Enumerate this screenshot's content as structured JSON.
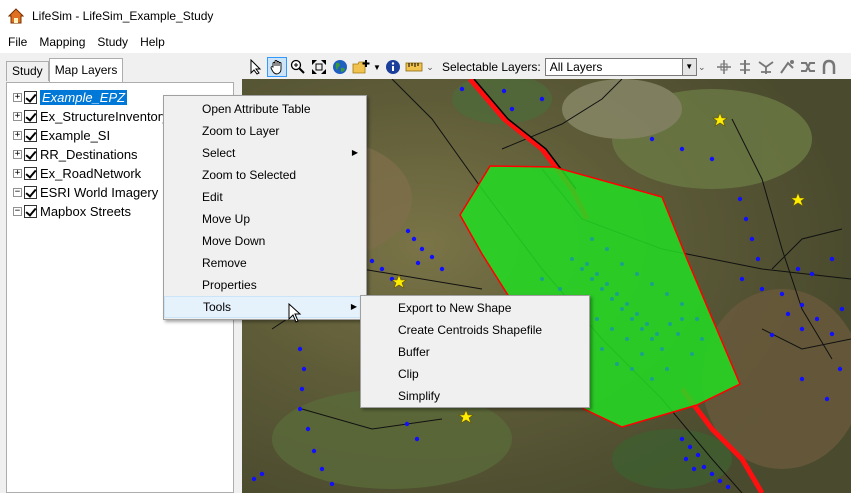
{
  "window": {
    "title": "LifeSim - LifeSim_Example_Study"
  },
  "menubar": {
    "items": [
      "File",
      "Mapping",
      "Study",
      "Help"
    ]
  },
  "tabs": [
    {
      "label": "Study",
      "active": false
    },
    {
      "label": "Map Layers",
      "active": true
    }
  ],
  "layers": [
    {
      "label": "Example_EPZ",
      "expander": "+",
      "checked": true,
      "selected": true
    },
    {
      "label": "Ex_StructureInventory",
      "expander": "+",
      "checked": true,
      "selected": false
    },
    {
      "label": "Example_SI",
      "expander": "+",
      "checked": true,
      "selected": false
    },
    {
      "label": "RR_Destinations",
      "expander": "+",
      "checked": true,
      "selected": false
    },
    {
      "label": "Ex_RoadNetwork",
      "expander": "+",
      "checked": true,
      "selected": false
    },
    {
      "label": "ESRI World Imagery",
      "expander": "−",
      "checked": true,
      "selected": false
    },
    {
      "label": "Mapbox Streets",
      "expander": "−",
      "checked": true,
      "selected": false
    }
  ],
  "toolbar": {
    "tools": [
      "pointer-icon",
      "pan-hand-icon",
      "zoom-in-icon",
      "full-extent-icon",
      "globe-icon",
      "add-layer-icon",
      "info-icon",
      "measure-icon"
    ],
    "selectable_layers_label": "Selectable Layers:",
    "selectable_layers_value": "All Layers",
    "right_tools": [
      "snap-icon",
      "node-icon",
      "split-icon",
      "join-icon",
      "merge-icon",
      "arc-icon"
    ]
  },
  "context_menu": {
    "items": [
      {
        "label": "Open Attribute Table",
        "submenu": false
      },
      {
        "label": "Zoom to Layer",
        "submenu": false
      },
      {
        "label": "Select",
        "submenu": true
      },
      {
        "label": "Zoom to Selected",
        "submenu": false
      },
      {
        "label": "Edit",
        "submenu": false
      },
      {
        "label": "Move Up",
        "submenu": false
      },
      {
        "label": "Move Down",
        "submenu": false
      },
      {
        "label": "Remove",
        "submenu": false
      },
      {
        "label": "Properties",
        "submenu": false
      },
      {
        "label": "Tools",
        "submenu": true,
        "hover": true
      }
    ]
  },
  "tools_submenu": {
    "items": [
      "Export to New Shape",
      "Create Centroids Shapefile",
      "Buffer",
      "Clip",
      "Simplify"
    ]
  },
  "colors": {
    "selection": "#0078d7",
    "epz_fill": "#22dd22",
    "epz_outline": "#ff0000",
    "structures": "#1010ff",
    "destinations": "#ffee00",
    "roads": "#ff0000"
  }
}
